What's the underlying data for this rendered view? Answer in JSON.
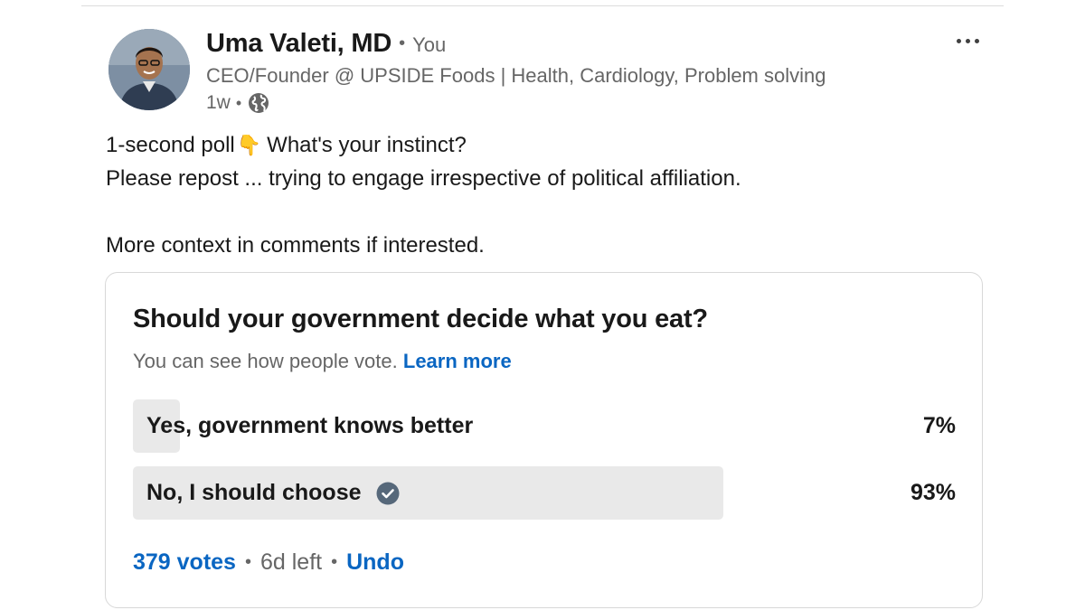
{
  "post": {
    "author": {
      "name": "Uma Valeti, MD",
      "you_label": "You",
      "headline": "CEO/Founder @ UPSIDE Foods | Health, Cardiology, Problem solving",
      "time": "1w",
      "separator": "•",
      "visibility_icon": "globe-icon"
    },
    "more_icon": "more-horizontal-icon",
    "body": {
      "line1_text": "1-second poll",
      "line1_emoji": "👇",
      "line1_rest": "What's your instinct?",
      "line2": "Please repost ... trying to engage irrespective of political affiliation.",
      "line3": "More context in comments if interested."
    }
  },
  "poll": {
    "question": "Should your government decide what you eat?",
    "note": "You can see how people vote.",
    "learn_more": "Learn more",
    "options": [
      {
        "label": "Yes, government knows better",
        "percent_label": "7%",
        "percent": 7,
        "selected": false
      },
      {
        "label": "No, I should choose",
        "percent_label": "93%",
        "percent": 93,
        "selected": true
      }
    ],
    "footer": {
      "votes": "379 votes",
      "separator": "•",
      "time_left": "6d left",
      "undo": "Undo"
    }
  },
  "colors": {
    "link": "#0a66c2",
    "bar_fill": "#e9e9e9",
    "muted_text": "#666666",
    "check_icon": "#56687a"
  }
}
